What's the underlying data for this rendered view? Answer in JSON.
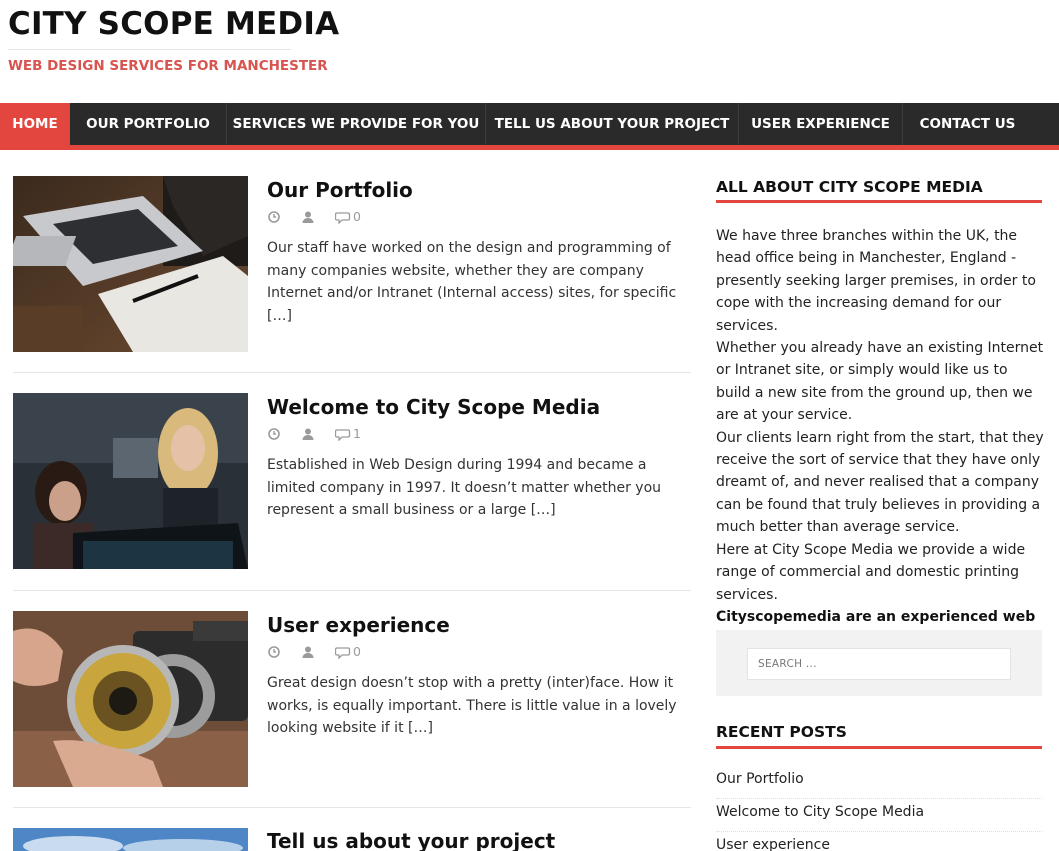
{
  "header": {
    "site_title": "CITY SCOPE MEDIA",
    "tagline": "WEB DESIGN SERVICES FOR MANCHESTER"
  },
  "nav": {
    "items": [
      {
        "label": "HOME",
        "active": true
      },
      {
        "label": "OUR PORTFOLIO",
        "active": false
      },
      {
        "label": "SERVICES WE PROVIDE FOR YOU",
        "active": false
      },
      {
        "label": "TELL US ABOUT YOUR PROJECT",
        "active": false
      },
      {
        "label": "USER EXPERIENCE",
        "active": false
      },
      {
        "label": "CONTACT US",
        "active": false
      }
    ]
  },
  "posts": [
    {
      "title": "Our Portfolio",
      "comments": "0",
      "excerpt": "Our staff have worked on the design and programming of many companies website, whether they are company Internet and/or Intranet (Internal access) sites, for specific […]",
      "image": "laptop-on-desk"
    },
    {
      "title": "Welcome to City Scope Media",
      "comments": "1",
      "excerpt": "Established in Web Design during 1994 and became a limited company in 1997. It doesn’t matter whether you represent a small business or a large […]",
      "image": "two-women-at-computer"
    },
    {
      "title": "User experience",
      "comments": "0",
      "excerpt": "Great design doesn’t stop with a pretty (inter)face. How it works, is equally important. There is little value in a lovely looking website if it […]",
      "image": "camera-lens-in-hand"
    },
    {
      "title": "Tell us about your project",
      "comments": "",
      "excerpt": "",
      "image": "sky"
    }
  ],
  "sidebar": {
    "about_title": "ALL ABOUT CITY SCOPE MEDIA",
    "about_paragraphs": [
      "We have three branches within the UK, the head office being in Manchester, England - presently seeking larger premises, in order to cope with the increasing demand for our services.",
      "Whether you already have an existing Internet or Intranet site, or simply would like us to build a new site from the ground up, then we are at your service.",
      "Our clients learn right from the start, that they receive the sort of service that they have only dreamt of, and never realised that a company can be found that truly believes in providing a much better than average service.",
      "Here at City Scope Media we provide a wide range of commercial and domestic printing services."
    ],
    "about_strong": "Cityscopemedia are an experienced web design studio in Manchester. Contact us.",
    "search_placeholder": "SEARCH ...",
    "recent_title": "RECENT POSTS",
    "recent_posts": [
      "Our Portfolio",
      "Welcome to City Scope Media",
      "User experience"
    ]
  },
  "colors": {
    "accent": "#e2463f",
    "nav_bg": "#2a2a2a"
  },
  "icons": [
    "clock-icon",
    "user-icon",
    "comment-icon"
  ]
}
